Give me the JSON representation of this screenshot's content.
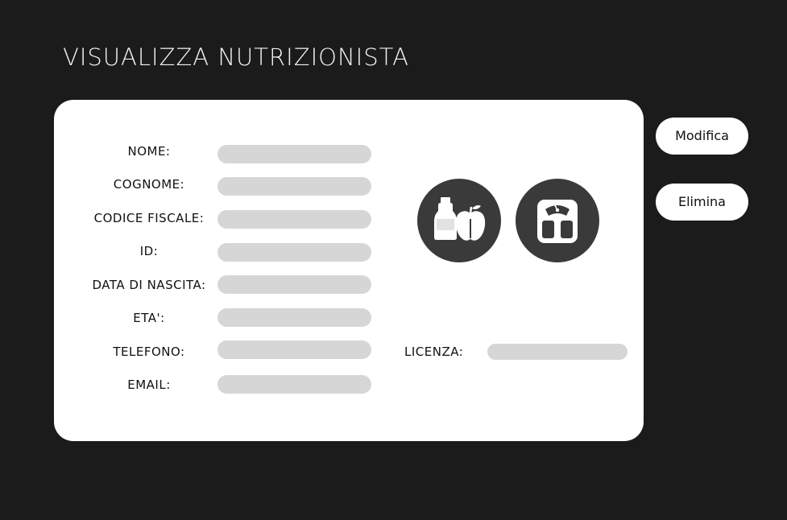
{
  "page": {
    "title": "VISUALIZZA NUTRIZIONISTA"
  },
  "fields": [
    {
      "label": "NOME:",
      "value": ""
    },
    {
      "label": "COGNOME:",
      "value": ""
    },
    {
      "label": "CODICE FISCALE:",
      "value": ""
    },
    {
      "label": "ID:",
      "value": ""
    },
    {
      "label": "DATA DI NASCITA:",
      "value": ""
    },
    {
      "label": "ETA':",
      "value": ""
    },
    {
      "label": "TELEFONO:",
      "value": ""
    },
    {
      "label": "EMAIL:",
      "value": ""
    }
  ],
  "licenza": {
    "label": "LICENZA:",
    "value": ""
  },
  "icons": [
    "nutrition-food-icon",
    "bathroom-scale-icon"
  ],
  "actions": {
    "edit_label": "Modifica",
    "delete_label": "Elimina"
  },
  "colors": {
    "background": "#1b1b1b",
    "card": "#ffffff",
    "field_fill": "#d6d6d6",
    "icon_circle": "#3a3a3a"
  }
}
